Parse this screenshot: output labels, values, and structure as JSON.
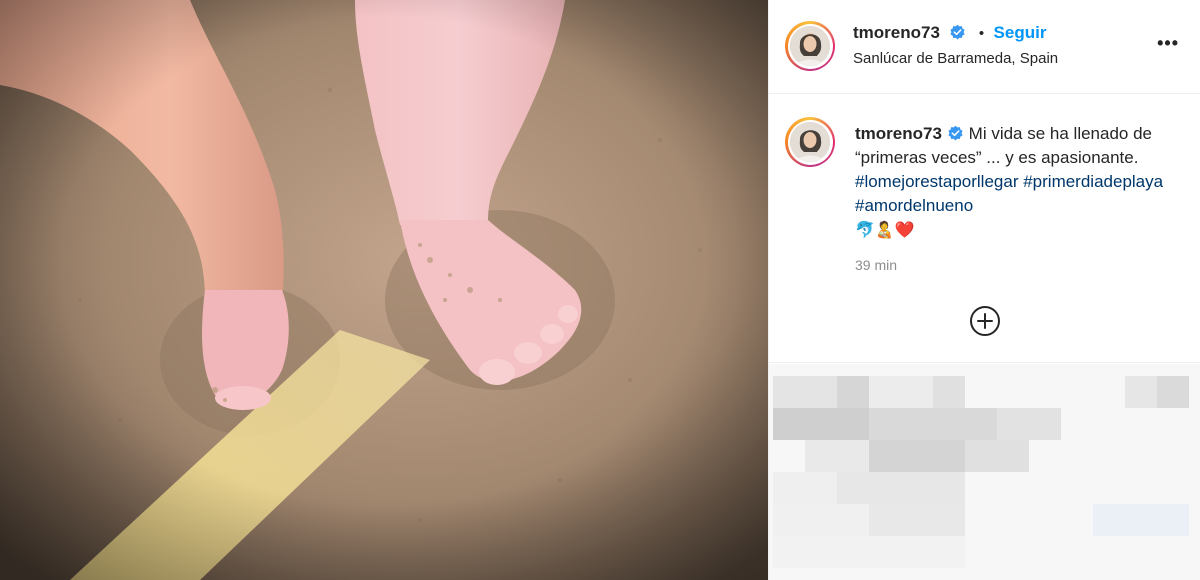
{
  "post": {
    "username": "tmoreno73",
    "follow_label": "Seguir",
    "location": "Sanlúcar de Barrameda, Spain",
    "more_label": "•••"
  },
  "caption": {
    "username": "tmoreno73",
    "text_1": "Mi vida se ha llenado de “primeras veces” ... y es apasionante.",
    "hashtags": [
      "#lomejorestaporllegar",
      "#primerdiadeplaya",
      "#amordelnueno"
    ],
    "emojis": "🐬🧑‍🍼❤️",
    "time": "39 min"
  },
  "colors": {
    "link_blue": "#0095f6",
    "hashtag_blue": "#00376b",
    "verified_blue": "#3897f0",
    "muted_gray": "#8e8e8e"
  },
  "icons": {
    "verified": "verified-badge-icon",
    "more": "more-options-icon",
    "add_comment": "add-circle-icon"
  }
}
